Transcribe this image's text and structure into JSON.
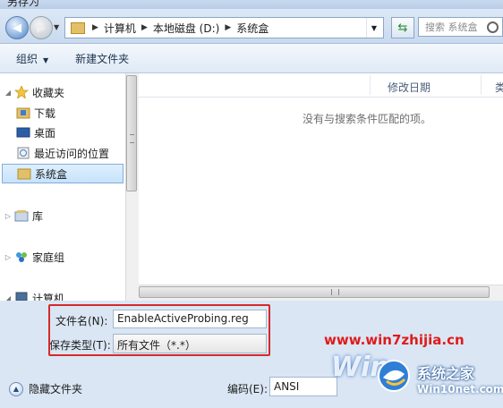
{
  "window": {
    "title": "另存为"
  },
  "address": {
    "crumbs": [
      "计算机",
      "本地磁盘 (D:)",
      "系统盒"
    ],
    "search_placeholder": "搜索 系统盒"
  },
  "toolbar": {
    "organize": "组织",
    "new_folder": "新建文件夹"
  },
  "nav": {
    "favorites": "收藏夹",
    "downloads": "下载",
    "desktop": "桌面",
    "recent": "最近访问的位置",
    "xitonghe": "系统盒",
    "libraries": "库",
    "homegroup": "家庭组",
    "computer": "计算机"
  },
  "columns": {
    "modified": "修改日期",
    "type_cut": "类"
  },
  "empty_message": "没有与搜索条件匹配的项。",
  "form": {
    "filename_label": "文件名(N):",
    "filename_value": "EnableActiveProbing.reg",
    "filetype_label": "保存类型(T):",
    "filetype_value": "所有文件（*.*）",
    "encoding_label": "编码(E):",
    "encoding_value": "ANSI",
    "hide_folders": "隐藏文件夹"
  },
  "watermark": {
    "url": "www.win7zhijia.cn",
    "brand_cn": "系统之家",
    "brand_en": "Win10net.com",
    "win_text": "Win"
  },
  "colors": {
    "highlight_box": "#d52a2a",
    "watermark_url": "#e01b1b",
    "selection": "#c6e3fb"
  }
}
